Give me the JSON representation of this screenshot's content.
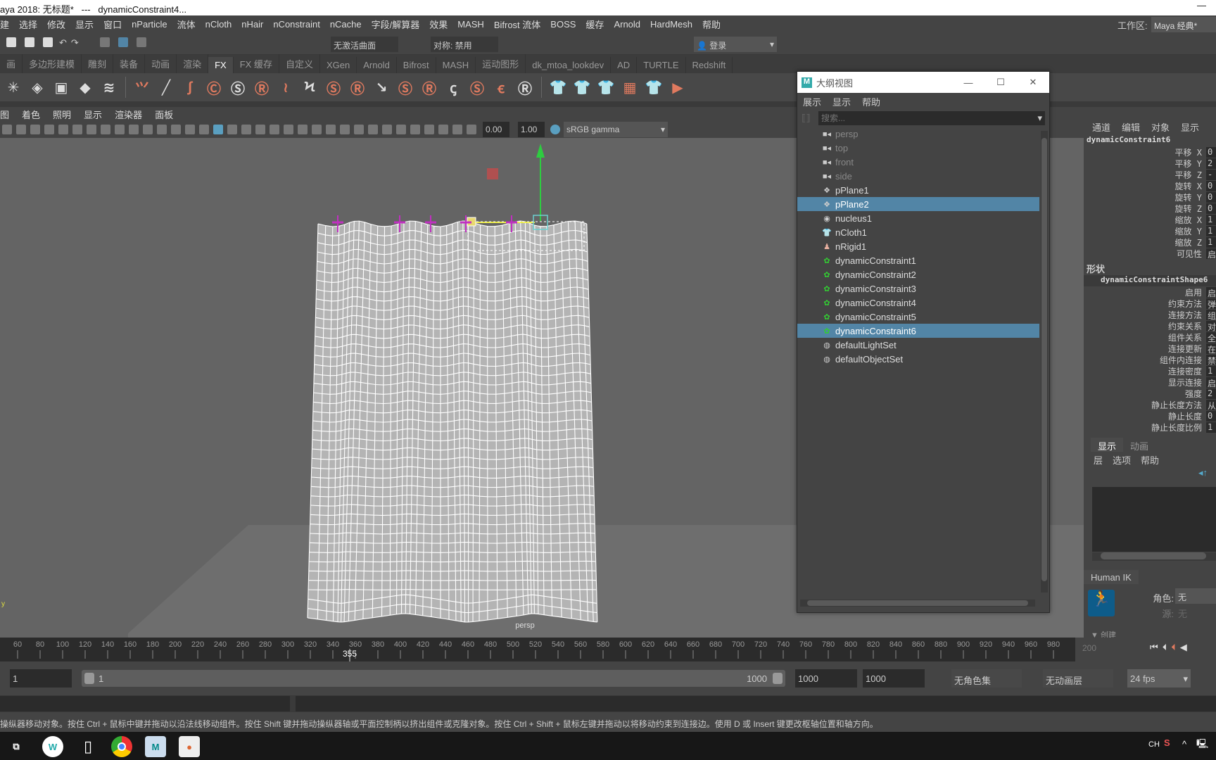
{
  "title": "aya 2018: 无标题*   ---   dynamicConstraint4...",
  "menu": [
    "建",
    "选择",
    "修改",
    "显示",
    "窗口",
    "nParticle",
    "流体",
    "nCloth",
    "nHair",
    "nConstraint",
    "nCache",
    "字段/解算器",
    "效果",
    "MASH",
    "Bifrost 流体",
    "BOSS",
    "缓存",
    "Arnold",
    "HardMesh",
    "帮助"
  ],
  "workspace": {
    "label": "工作区:",
    "value": "Maya 经典*"
  },
  "statusline": {
    "live_surface": "无激活曲面",
    "symmetry": "对称: 禁用",
    "login": "登录"
  },
  "shelf_tabs": [
    "画",
    "多边形建模",
    "雕刻",
    "装备",
    "动画",
    "渲染",
    "FX",
    "FX 缓存",
    "自定义",
    "XGen",
    "Arnold",
    "Bifrost",
    "MASH",
    "运动图形",
    "dk_mtoa_lookdev",
    "AD",
    "TURTLE",
    "Redshift"
  ],
  "shelf_active": "FX",
  "shelf_icons": [
    "emitter",
    "fluid-container",
    "fluid-2d",
    "fluid-3d",
    "fluid-add",
    "hair-create",
    "hair-paint",
    "curve-dynamic",
    "nconstraint-c",
    "nconstraint-s",
    "nconstraint-r",
    "hair-cut",
    "hair-scale",
    "brush-s",
    "brush-r",
    "hair-a",
    "hair-s2",
    "hair-r2",
    "cs",
    "cs2",
    "cr",
    "cr2",
    "ncloth-create",
    "ncloth-passive",
    "ncloth-remove",
    "ncloth-cache",
    "ncloth-shirt",
    "play-sim"
  ],
  "shelf_glyphs": [
    "✳",
    "◈",
    "▣",
    "◆",
    "≋",
    "⺍",
    "╱",
    "∫",
    "Ⓒ",
    "Ⓢ",
    "Ⓡ",
    "≀",
    "Ϟ",
    "Ⓢ",
    "Ⓡ",
    "↘",
    "Ⓢ",
    "Ⓡ",
    "ꞔ",
    "Ⓢ",
    "ꞓ",
    "Ⓡ",
    "👕",
    "👕",
    "👕",
    "▦",
    "👕",
    "▶"
  ],
  "panel_menu": [
    "图",
    "着色",
    "照明",
    "显示",
    "渲染器",
    "面板"
  ],
  "panel_tools": {
    "exposure": "0.00",
    "gamma": "1.00",
    "colorspace": "sRGB gamma"
  },
  "viewport": {
    "camera_label": "persp"
  },
  "outliner": {
    "title": "大纲视图",
    "menu": [
      "展示",
      "显示",
      "帮助"
    ],
    "search_placeholder": "搜索...",
    "items": [
      {
        "label": "persp",
        "icon": "camera-icon",
        "dim": true
      },
      {
        "label": "top",
        "icon": "camera-icon",
        "dim": true
      },
      {
        "label": "front",
        "icon": "camera-icon",
        "dim": true
      },
      {
        "label": "side",
        "icon": "camera-icon",
        "dim": true
      },
      {
        "label": "pPlane1",
        "icon": "mesh-icon"
      },
      {
        "label": "pPlane2",
        "icon": "mesh-icon",
        "selected": true
      },
      {
        "label": "nucleus1",
        "icon": "nucleus-icon"
      },
      {
        "label": "nCloth1",
        "icon": "ncloth-icon"
      },
      {
        "label": "nRigid1",
        "icon": "nrigid-icon"
      },
      {
        "label": "dynamicConstraint1",
        "icon": "dynamic-constraint-icon"
      },
      {
        "label": "dynamicConstraint2",
        "icon": "dynamic-constraint-icon"
      },
      {
        "label": "dynamicConstraint3",
        "icon": "dynamic-constraint-icon"
      },
      {
        "label": "dynamicConstraint4",
        "icon": "dynamic-constraint-icon"
      },
      {
        "label": "dynamicConstraint5",
        "icon": "dynamic-constraint-icon"
      },
      {
        "label": "dynamicConstraint6",
        "icon": "dynamic-constraint-icon",
        "selected": true
      },
      {
        "label": "defaultLightSet",
        "icon": "set-icon"
      },
      {
        "label": "defaultObjectSet",
        "icon": "set-icon"
      }
    ]
  },
  "channel_box": {
    "menu": [
      "通道",
      "编辑",
      "对象",
      "显示"
    ],
    "object": "dynamicConstraint6",
    "channels": [
      [
        "平移 X",
        "0"
      ],
      [
        "平移 Y",
        "2"
      ],
      [
        "平移 Z",
        "-"
      ],
      [
        "旋转 X",
        "0"
      ],
      [
        "旋转 Y",
        "0"
      ],
      [
        "旋转 Z",
        "0"
      ],
      [
        "缩放 X",
        "1"
      ],
      [
        "缩放 Y",
        "1"
      ],
      [
        "缩放 Z",
        "1"
      ],
      [
        "可见性",
        "启"
      ]
    ],
    "shape_header": "形状",
    "shape": "dynamicConstraintShape6",
    "shape_channels": [
      [
        "启用",
        "启"
      ],
      [
        "约束方法",
        "弹"
      ],
      [
        "连接方法",
        "组"
      ],
      [
        "约束关系",
        "对"
      ],
      [
        "组件关系",
        "全"
      ],
      [
        "连接更新",
        "在"
      ],
      [
        "组件内连接",
        "禁"
      ],
      [
        "连接密度",
        "1"
      ],
      [
        "显示连接",
        "启"
      ],
      [
        "强度",
        "2"
      ],
      [
        "静止长度方法",
        "从"
      ],
      [
        "静止长度",
        "0"
      ],
      [
        "静止长度比例",
        "1"
      ]
    ]
  },
  "layer_editor": {
    "tabs": [
      "显示",
      "动画"
    ],
    "menu": [
      "层",
      "选项",
      "帮助"
    ]
  },
  "human_ik": {
    "title": "Human IK",
    "character_label": "角色:",
    "character_value": "无",
    "source_label": "源:",
    "source_value": "无",
    "section": "创建"
  },
  "timeline": {
    "ticks": [
      60,
      80,
      100,
      120,
      140,
      160,
      180,
      200,
      220,
      240,
      260,
      280,
      300,
      320,
      340,
      360,
      380,
      400,
      420,
      440,
      460,
      480,
      500,
      520,
      540,
      560,
      580,
      600,
      620,
      640,
      660,
      680,
      700,
      720,
      740,
      760,
      780,
      800,
      820,
      840,
      860,
      880,
      900,
      920,
      940,
      960,
      980
    ],
    "current_frame": "355",
    "current_value": 355,
    "end_field": "200"
  },
  "range": {
    "start": "1",
    "slider_start": "1",
    "slider_end": "1000",
    "end": "1000",
    "max": "1000",
    "character_set": "无角色集",
    "anim_layer": "无动画层",
    "fps": "24 fps"
  },
  "help_line": "操纵器移动对象。按住 Ctrl + 鼠标中键并拖动以沿法线移动组件。按住 Shift 键并拖动操纵器轴或平面控制柄以挤出组件或克隆对象。按住 Ctrl + Shift + 鼠标左键并拖动以将移动约束到连接边。使用 D 或 Insert 键更改枢轴位置和轴方向。",
  "taskbar": {
    "ime": "CH",
    "apps": [
      "task-view",
      "wps",
      "file",
      "chrome",
      "maya",
      "slides"
    ]
  },
  "colors": {
    "selection": "#5285a6",
    "viewport": "#646464",
    "accent_shelf": "#e07a5f",
    "constraint_magenta": "#c030c0"
  }
}
